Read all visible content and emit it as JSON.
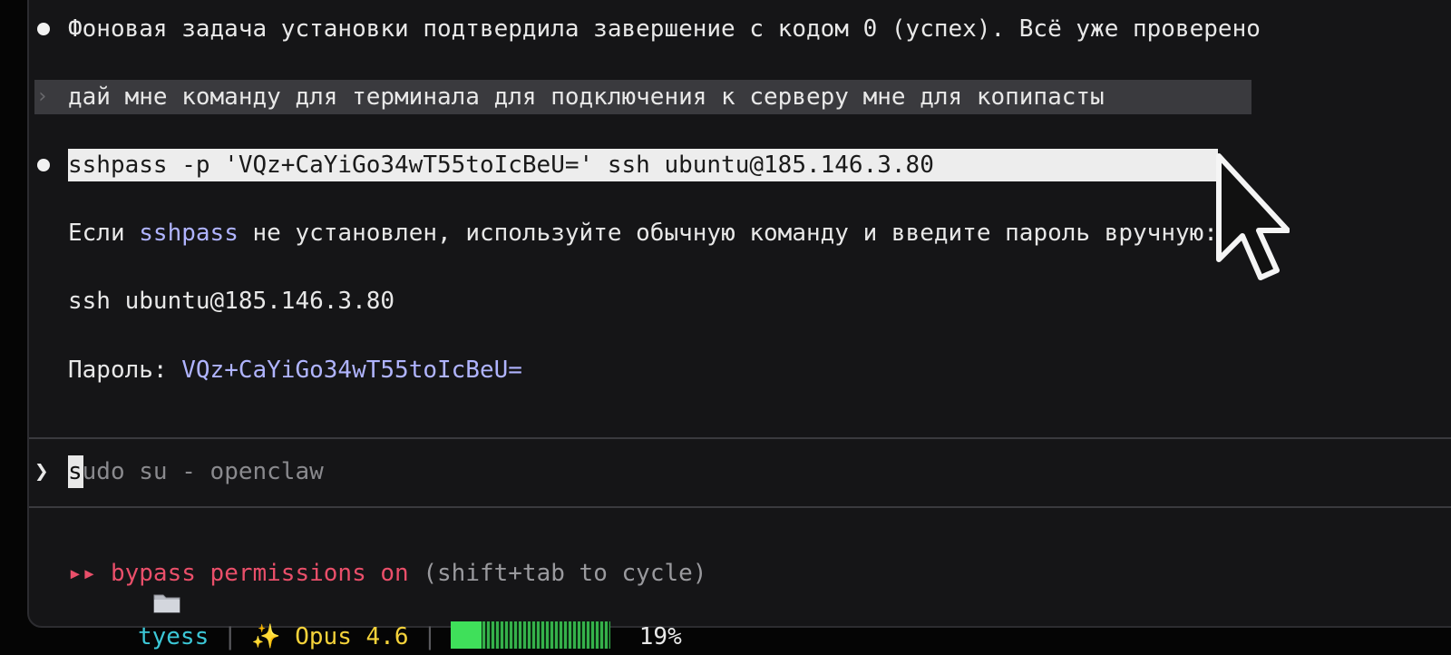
{
  "messages": {
    "status_line": "Фоновая задача установки подтвердила завершение с кодом 0 (успех). Всё уже проверено",
    "user_prompt": "дай мне команду для терминала для подключения к серверу мне для копипасты",
    "command": "sshpass -p 'VQz+CaYiGo34wT55toIcBeU=' ssh ubuntu@185.146.3.80",
    "hint_pre": "Если ",
    "hint_code": "sshpass",
    "hint_post": " не установлен, используйте обычную команду и введите пароль вручную:",
    "plain_command": "ssh ubuntu@185.146.3.80",
    "password_label": "Пароль: ",
    "password_value": "VQz+CaYiGo34wT55toIcBeU="
  },
  "input": {
    "prompt_symbol": "❯",
    "cursor_char": "s",
    "rest_text": "udo su - openclaw"
  },
  "status": {
    "folder_icon": "folder-icon",
    "folder_name": "tyess",
    "sparkle_icon": "sparkles-icon",
    "sparkle_glyph": "✨",
    "model": "Opus 4.6",
    "separator": "|",
    "context_percent_label": "19%",
    "context_fraction": 0.19,
    "mode_arrows": "▸▸",
    "mode_text": "bypass permissions on",
    "mode_hint": "(shift+tab to cycle)"
  },
  "colors": {
    "accent": "#b0b4ff",
    "teal": "#3cc7d6",
    "yellow": "#f4d23a",
    "red": "#ea4f6a",
    "progress": "#3fe05a"
  }
}
